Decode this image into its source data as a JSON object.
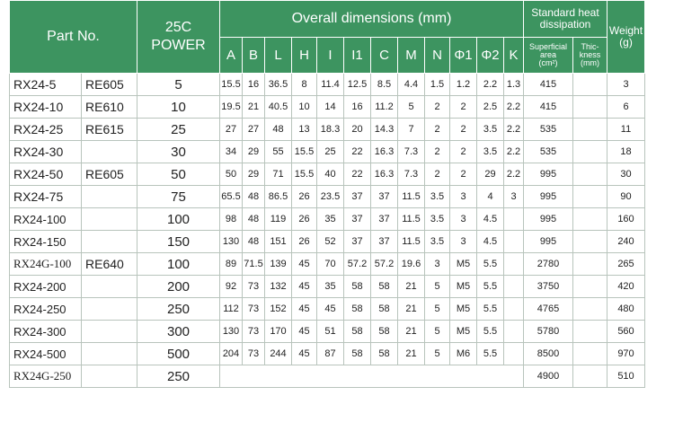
{
  "header": {
    "part_no": "Part No.",
    "power_line1": "25C",
    "power_line2": "POWER",
    "overall_dimensions": "Overall dimensions (mm)",
    "heat_title_line1": "Standard heat",
    "heat_title_line2": "dissipation",
    "weight_line1": "Weight",
    "weight_line2": "(g)",
    "dim_columns": [
      "A",
      "B",
      "L",
      "H",
      "I",
      "I1",
      "C",
      "M",
      "N",
      "Φ1",
      "Φ2",
      "K"
    ],
    "area_line1": "Superficial",
    "area_line2": "area",
    "area_line3": "(cm²)",
    "thick_line1": "Thic-",
    "thick_line2": "kness",
    "thick_line3": "(mm)"
  },
  "rows": [
    {
      "part": "RX24-5",
      "ref": "RE605",
      "power": "5",
      "dims": [
        "15.5",
        "16",
        "36.5",
        "8",
        "11.4",
        "12.5",
        "8.5",
        "4.4",
        "1.5",
        "1.2",
        "2.2",
        "1.3"
      ],
      "area": "415",
      "thickness": "",
      "weight": "3"
    },
    {
      "part": "RX24-10",
      "ref": "RE610",
      "power": "10",
      "dims": [
        "19.5",
        "21",
        "40.5",
        "10",
        "14",
        "16",
        "11.2",
        "5",
        "2",
        "2",
        "2.5",
        "2.2"
      ],
      "area": "415",
      "thickness": "",
      "weight": "6"
    },
    {
      "part": "RX24-25",
      "ref": "RE615",
      "power": "25",
      "dims": [
        "27",
        "27",
        "48",
        "13",
        "18.3",
        "20",
        "14.3",
        "7",
        "2",
        "2",
        "3.5",
        "2.2"
      ],
      "area": "535",
      "thickness": "",
      "weight": "11"
    },
    {
      "part": "RX24-30",
      "ref": "",
      "power": "30",
      "dims": [
        "34",
        "29",
        "55",
        "15.5",
        "25",
        "22",
        "16.3",
        "7.3",
        "2",
        "2",
        "3.5",
        "2.2"
      ],
      "area": "535",
      "thickness": "",
      "weight": "18"
    },
    {
      "part": "RX24-50",
      "ref": "RE605",
      "power": "50",
      "dims": [
        "50",
        "29",
        "71",
        "15.5",
        "40",
        "22",
        "16.3",
        "7.3",
        "2",
        "2",
        "29",
        "2.2"
      ],
      "area": "995",
      "thickness": "",
      "weight": "30"
    },
    {
      "part": "RX24-75",
      "ref": "",
      "power": "75",
      "dims": [
        "65.5",
        "48",
        "86.5",
        "26",
        "23.5",
        "37",
        "37",
        "11.5",
        "3.5",
        "3",
        "4",
        "3"
      ],
      "area": "995",
      "thickness": "",
      "weight": "90"
    },
    {
      "part": "RX24-100",
      "ref": "",
      "power": "100",
      "dims": [
        "98",
        "48",
        "119",
        "26",
        "35",
        "37",
        "37",
        "11.5",
        "3.5",
        "3",
        "4.5",
        ""
      ],
      "area": "995",
      "thickness": "",
      "weight": "160"
    },
    {
      "part": "RX24-150",
      "ref": "",
      "power": "150",
      "dims": [
        "130",
        "48",
        "151",
        "26",
        "52",
        "37",
        "37",
        "11.5",
        "3.5",
        "3",
        "4.5",
        ""
      ],
      "area": "995",
      "thickness": "",
      "weight": "240"
    },
    {
      "part": "RX24G-100",
      "ref": "RE640",
      "power": "100",
      "dims": [
        "89",
        "71.5",
        "139",
        "45",
        "70",
        "57.2",
        "57.2",
        "19.6",
        "3",
        "M5",
        "5.5",
        ""
      ],
      "area": "2780",
      "thickness": "",
      "weight": "265"
    },
    {
      "part": "RX24-200",
      "ref": "",
      "power": "200",
      "dims": [
        "92",
        "73",
        "132",
        "45",
        "35",
        "58",
        "58",
        "21",
        "5",
        "M5",
        "5.5",
        ""
      ],
      "area": "3750",
      "thickness": "",
      "weight": "420"
    },
    {
      "part": "RX24-250",
      "ref": "",
      "power": "250",
      "dims": [
        "112",
        "73",
        "152",
        "45",
        "45",
        "58",
        "58",
        "21",
        "5",
        "M5",
        "5.5",
        ""
      ],
      "area": "4765",
      "thickness": "",
      "weight": "480"
    },
    {
      "part": "RX24-300",
      "ref": "",
      "power": "300",
      "dims": [
        "130",
        "73",
        "170",
        "45",
        "51",
        "58",
        "58",
        "21",
        "5",
        "M5",
        "5.5",
        ""
      ],
      "area": "5780",
      "thickness": "",
      "weight": "560"
    },
    {
      "part": "RX24-500",
      "ref": "",
      "power": "500",
      "dims": [
        "204",
        "73",
        "244",
        "45",
        "87",
        "58",
        "58",
        "21",
        "5",
        "M6",
        "5.5",
        ""
      ],
      "area": "8500",
      "thickness": "",
      "weight": "970"
    }
  ],
  "last_row": {
    "part": "RX24G-250",
    "ref": "",
    "power": "250",
    "area": "4900",
    "thickness": "",
    "weight": "510"
  }
}
